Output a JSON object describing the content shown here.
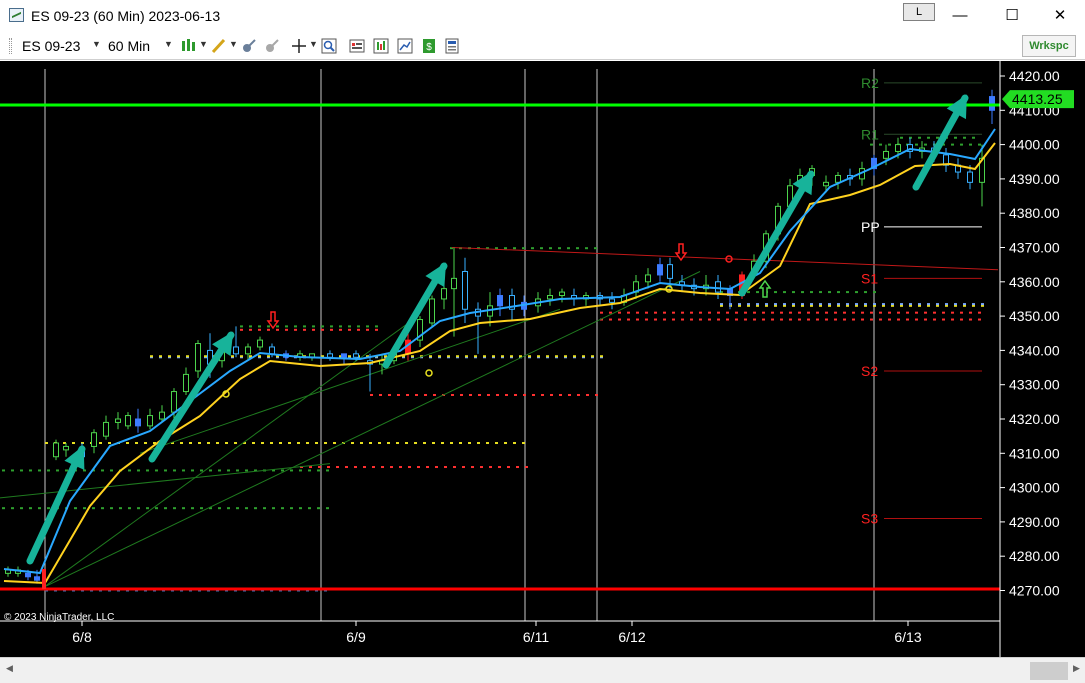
{
  "window": {
    "title": "ES 09-23 (60 Min)  2023-06-13",
    "link_label": "L",
    "minimize_glyph": "—",
    "maximize_glyph": "☐",
    "close_glyph": "✕"
  },
  "toolbar": {
    "instrument": "ES 09-23",
    "interval": "60 Min",
    "workspace_label": "Wrkspc",
    "icons": [
      "bar-type-icon",
      "drawing-tool-icon",
      "indicators-icon",
      "strategies-icon",
      "crosshair-icon",
      "zoom-icon",
      "properties-icon",
      "chart-style-icon",
      "data-series-icon",
      "chart-trader-icon",
      "templates-icon"
    ]
  },
  "chart": {
    "copyright": "© 2023 NinjaTrader, LLC",
    "last_price_label": "4413.25",
    "price_axis_labels": [
      "4420.00",
      "4410.00",
      "4400.00",
      "4390.00",
      "4380.00",
      "4370.00",
      "4360.00",
      "4350.00",
      "4340.00",
      "4330.00",
      "4320.00",
      "4310.00",
      "4300.00",
      "4290.00",
      "4280.00",
      "4270.00"
    ],
    "date_labels": [
      "6/8",
      "6/9",
      "6/11",
      "6/12",
      "6/13"
    ],
    "pivot_labels": [
      "R2",
      "R1",
      "PP",
      "S1",
      "S2",
      "S3"
    ],
    "colors": {
      "background": "#000000",
      "resistance_line": "#00ff00",
      "support_line": "#ff0000",
      "ema_fast": "#29a8ff",
      "ema_slow": "#ffd21f",
      "arrow": "#17b39a",
      "pivot_green": "#2e8b2e",
      "pivot_red": "#ff2020",
      "pivot_white": "#ffffff"
    }
  }
}
